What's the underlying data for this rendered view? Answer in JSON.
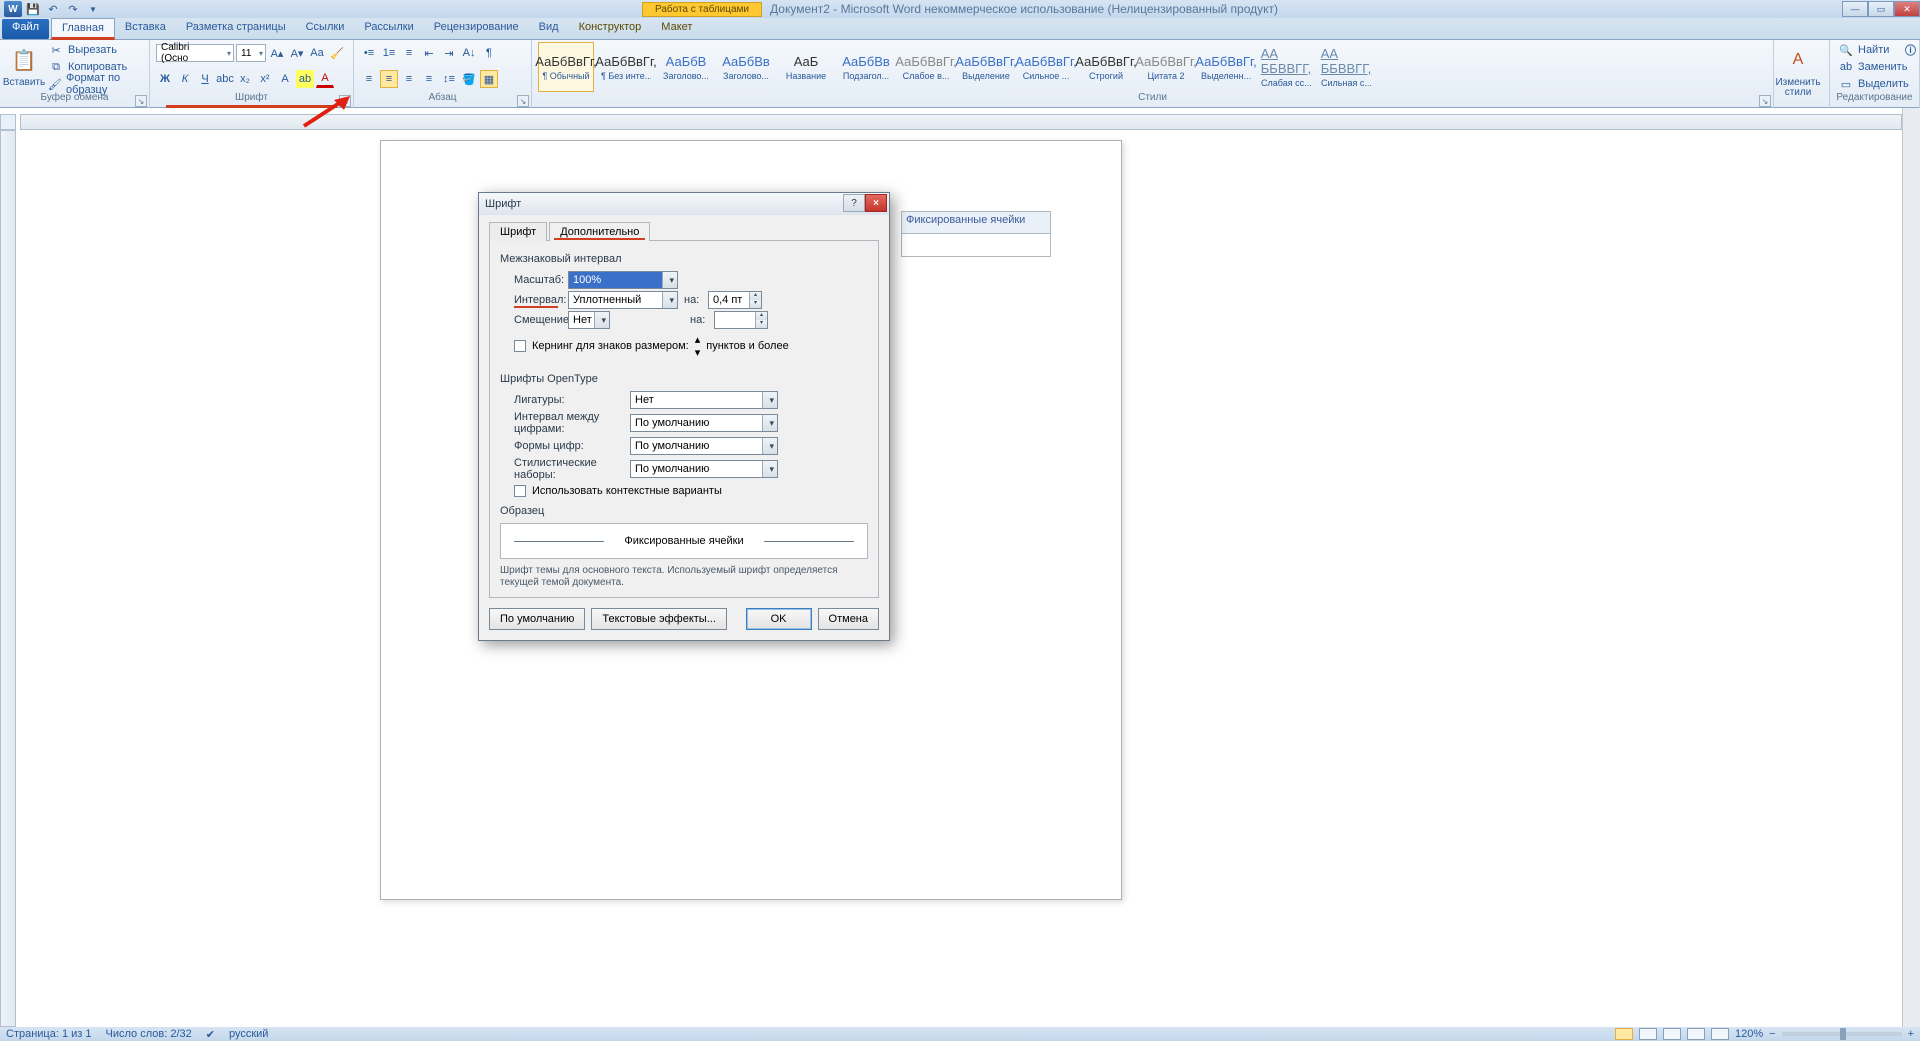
{
  "window": {
    "table_tools": "Работа с таблицами",
    "title": "Документ2 - Microsoft Word некоммерческое использование (Нелицензированный продукт)"
  },
  "tabs": {
    "file": "Файл",
    "home": "Главная",
    "insert": "Вставка",
    "layout": "Разметка страницы",
    "refs": "Ссылки",
    "mail": "Рассылки",
    "review": "Рецензирование",
    "view": "Вид",
    "design": "Конструктор",
    "tlayout": "Макет"
  },
  "clipboard": {
    "paste": "Вставить",
    "cut": "Вырезать",
    "copy": "Копировать",
    "painter": "Формат по образцу",
    "label": "Буфер обмена"
  },
  "font": {
    "name": "Calibri (Осно",
    "size": "11",
    "label": "Шрифт"
  },
  "para": {
    "label": "Абзац"
  },
  "styles": {
    "label": "Стили",
    "change": "Изменить стили",
    "items": [
      {
        "p": "АаБбВвГг,",
        "n": "¶ Обычный"
      },
      {
        "p": "АаБбВвГг,",
        "n": "¶ Без инте..."
      },
      {
        "p": "АаБбВ",
        "n": "Заголово..."
      },
      {
        "p": "АаБбВв",
        "n": "Заголово..."
      },
      {
        "p": "АаБ",
        "n": "Название"
      },
      {
        "p": "АаБбВв",
        "n": "Подзагол..."
      },
      {
        "p": "АаБбВвГг,",
        "n": "Слабое в..."
      },
      {
        "p": "АаБбВвГг,",
        "n": "Выделение"
      },
      {
        "p": "АаБбВвГг,",
        "n": "Сильное ..."
      },
      {
        "p": "АаБбВвГг,",
        "n": "Строгий"
      },
      {
        "p": "АаБбВвГг,",
        "n": "Цитата 2"
      },
      {
        "p": "АаБбВвГг,",
        "n": "Выделенн..."
      },
      {
        "p": "АА ББВВГГ,",
        "n": "Слабая сс..."
      },
      {
        "p": "АА ББВВГГ,",
        "n": "Сильная с..."
      }
    ]
  },
  "edit": {
    "find": "Найти",
    "replace": "Заменить",
    "select": "Выделить",
    "label": "Редактирование"
  },
  "doc": {
    "cell_text": "Фиксированные ячейки"
  },
  "dialog": {
    "title": "Шрифт",
    "tab_font": "Шрифт",
    "tab_adv": "Дополнительно",
    "sec_spacing": "Межзнаковый интервал",
    "scale_l": "Масштаб:",
    "scale_v": "100%",
    "interval_l": "Интервал:",
    "interval_v": "Уплотненный",
    "na": "на:",
    "interval_amt": "0,4 пт",
    "pos_l": "Смещение:",
    "pos_v": "Нет",
    "kerning": "Кернинг для знаков размером:",
    "kerning_suffix": "пунктов и более",
    "sec_ot": "Шрифты OpenType",
    "lig_l": "Лигатуры:",
    "lig_v": "Нет",
    "numsp_l": "Интервал между цифрами:",
    "numsp_v": "По умолчанию",
    "numf_l": "Формы цифр:",
    "numf_v": "По умолчанию",
    "styset_l": "Стилистические наборы:",
    "styset_v": "По умолчанию",
    "ctx": "Использовать контекстные варианты",
    "sample_l": "Образец",
    "sample_t": "Фиксированные ячейки",
    "note": "Шрифт темы для основного текста. Используемый шрифт определяется текущей темой документа.",
    "default": "По умолчанию",
    "texteff": "Текстовые эффекты...",
    "ok": "OK",
    "cancel": "Отмена"
  },
  "status": {
    "page": "Страница: 1 из 1",
    "words": "Число слов: 2/32",
    "lang": "русский",
    "zoom": "120%"
  }
}
